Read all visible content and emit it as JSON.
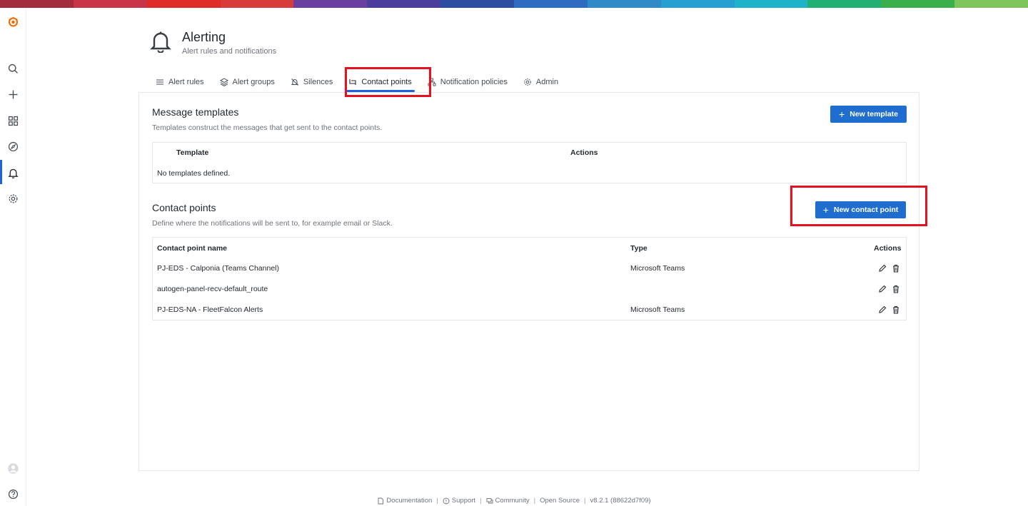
{
  "topbar_colors": [
    "#a42d3d",
    "#c93548",
    "#e02b2b",
    "#d93a3a",
    "#6a3fa0",
    "#4a3d9b",
    "#2b4ea1",
    "#2d6cc0",
    "#2f8ac8",
    "#26a0d0",
    "#1eb3c9",
    "#20b073",
    "#3bb04a",
    "#7ec55b"
  ],
  "accent": "#1f62e0",
  "button_color": "#1f6ecf",
  "highlight_color": "#e5111e",
  "sidebar": {
    "items": [
      {
        "icon": "search-icon"
      },
      {
        "icon": "plus-icon"
      },
      {
        "icon": "dashboards-icon"
      },
      {
        "icon": "explore-icon"
      },
      {
        "icon": "alerting-bell-icon"
      },
      {
        "icon": "gear-icon"
      }
    ],
    "bottom": [
      {
        "icon": "user-avatar-icon"
      },
      {
        "icon": "help-icon"
      }
    ]
  },
  "header": {
    "title": "Alerting",
    "subtitle": "Alert rules and notifications"
  },
  "tabs": [
    {
      "label": "Alert rules",
      "icon": "list-icon"
    },
    {
      "label": "Alert groups",
      "icon": "layers-icon"
    },
    {
      "label": "Silences",
      "icon": "bell-slash-icon"
    },
    {
      "label": "Contact points",
      "icon": "contact-icon",
      "active": true
    },
    {
      "label": "Notification policies",
      "icon": "sitemap-icon"
    },
    {
      "label": "Admin",
      "icon": "cog-icon"
    }
  ],
  "templates": {
    "title": "Message templates",
    "description": "Templates construct the messages that get sent to the contact points.",
    "button": "New template",
    "columns": [
      "Template",
      "Actions"
    ],
    "empty": "No templates defined."
  },
  "contact_points": {
    "title": "Contact points",
    "description": "Define where the notifications will be sent to, for example email or Slack.",
    "button": "New contact point",
    "columns": [
      "Contact point name",
      "Type",
      "Actions"
    ],
    "rows": [
      {
        "name": "PJ-EDS - Calponia (Teams Channel)",
        "type": "Microsoft Teams"
      },
      {
        "name": "autogen-panel-recv-default_route",
        "type": ""
      },
      {
        "name": "PJ-EDS-NA - FleetFalcon Alerts",
        "type": "Microsoft Teams"
      }
    ]
  },
  "footer": {
    "documentation": "Documentation",
    "support": "Support",
    "community": "Community",
    "open_source": "Open Source",
    "version": "v8.2.1 (88622d7f09)"
  }
}
